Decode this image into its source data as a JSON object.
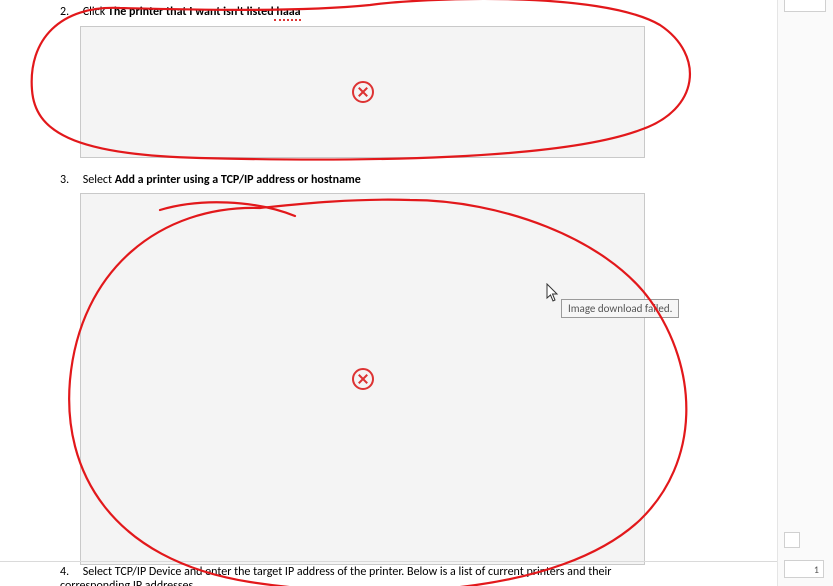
{
  "items": {
    "i2": {
      "num": "2.",
      "prefix": "Click ",
      "bold": "The printer that I want isn't listed",
      "spellword": " haaa"
    },
    "i3": {
      "num": "3.",
      "prefix": "Select ",
      "bold": "Add a printer using a TCP/IP address or hostname"
    },
    "i4": {
      "num": "4.",
      "text_a": "Select TCP/IP Device and enter the target IP address of the printer. Below is a list of current printers and their",
      "text_b": "corresponding IP addresses."
    }
  },
  "tooltip": "Image download failed.",
  "sidebar": {
    "page_number": "1"
  }
}
